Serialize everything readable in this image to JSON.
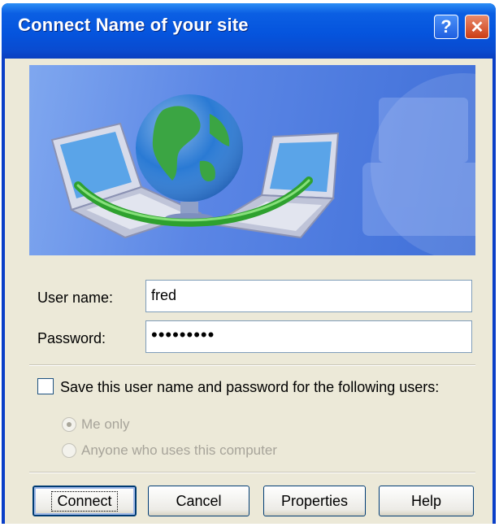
{
  "window": {
    "title": "Connect Name of your site",
    "help_button": "?",
    "close_button": "✕"
  },
  "form": {
    "username_label": "User name:",
    "username_value": "fred",
    "password_label": "Password:",
    "password_value": "•••••••••"
  },
  "save_options": {
    "checkbox_label": "Save this user name and password for the following users:",
    "checked": false,
    "radio_me_only": "Me only",
    "radio_anyone": "Anyone who uses this computer",
    "selected": "Me only"
  },
  "buttons": {
    "connect": "Connect",
    "cancel": "Cancel",
    "properties": "Properties",
    "help": "Help"
  },
  "colors": {
    "titlebar": "#0554dd",
    "dialog_background": "#ece9d8",
    "banner_blue": "#5b86e5"
  },
  "icons": [
    "globe-icon",
    "laptop-icon",
    "help-icon",
    "close-icon"
  ]
}
